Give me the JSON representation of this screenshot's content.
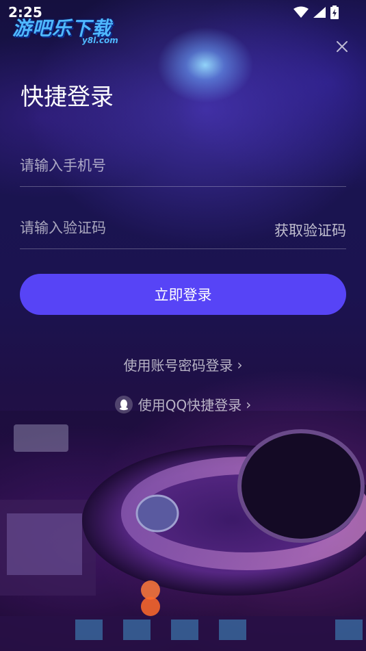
{
  "status_bar": {
    "time": "2:25"
  },
  "watermark": {
    "title": "游吧乐下载",
    "subtitle": "y8l.com"
  },
  "header": {
    "title": "快捷登录",
    "close_icon": "close-icon"
  },
  "form": {
    "phone_placeholder": "请输入手机号",
    "phone_value": "",
    "code_placeholder": "请输入验证码",
    "code_value": "",
    "get_code_label": "获取验证码",
    "submit_label": "立即登录"
  },
  "alternatives": {
    "account_login_label": "使用账号密码登录",
    "qq_login_label": "使用QQ快捷登录",
    "qq_icon": "qq-penguin-icon",
    "chevron_icon": "chevron-right-icon"
  },
  "colors": {
    "accent": "#5744f6",
    "watermark": "#4fb8ff"
  }
}
